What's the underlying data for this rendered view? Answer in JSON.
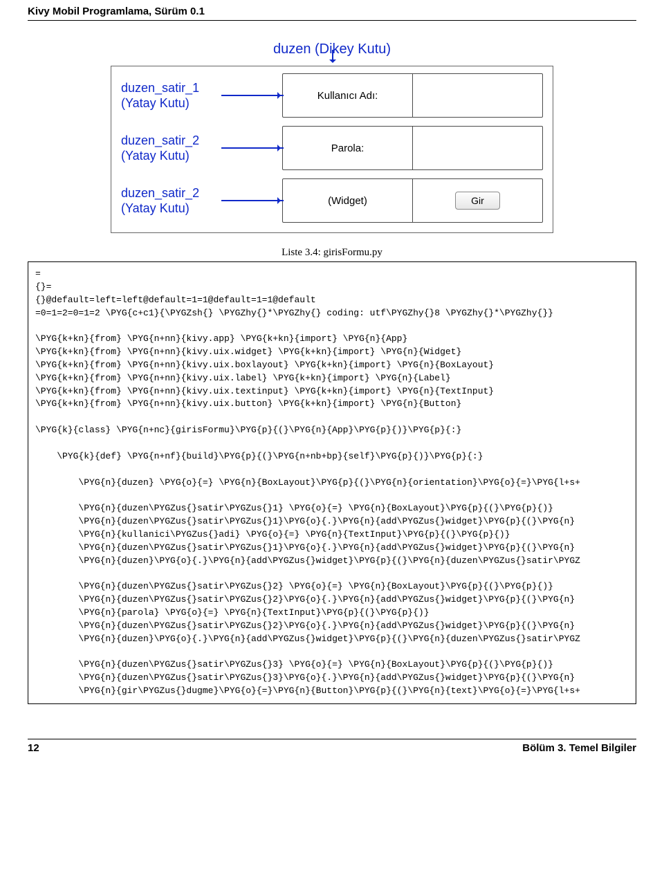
{
  "header": {
    "title": "Kivy Mobil Programlama, Sürüm 0.1"
  },
  "figure": {
    "title": "duzen (Dikey Kutu)",
    "rows": [
      {
        "caption_line1": "duzen_satir_1",
        "caption_line2": "(Yatay Kutu)",
        "cell1": "Kullanıcı Adı:",
        "cell2": ""
      },
      {
        "caption_line1": "duzen_satir_2",
        "caption_line2": "(Yatay Kutu)",
        "cell1": "Parola:",
        "cell2": ""
      },
      {
        "caption_line1": "duzen_satir_2",
        "caption_line2": "(Yatay Kutu)",
        "cell1": "(Widget)",
        "button": "Gir"
      }
    ]
  },
  "listing_caption": "Liste 3.4: girisFormu.py",
  "code": {
    "l1": "=",
    "l2": "{}=",
    "l3": "{}@default=left=left@default=1=1@default=1=1@default",
    "l4": "=0=1=2=0=1=2 \\PYG{c+c1}{\\PYGZsh{} \\PYGZhy{}*\\PYGZhy{} coding: utf\\PYGZhy{}8 \\PYGZhy{}*\\PYGZhy{}}",
    "l6": "\\PYG{k+kn}{from} \\PYG{n+nn}{kivy.app} \\PYG{k+kn}{import} \\PYG{n}{App}",
    "l7": "\\PYG{k+kn}{from} \\PYG{n+nn}{kivy.uix.widget} \\PYG{k+kn}{import} \\PYG{n}{Widget}",
    "l8": "\\PYG{k+kn}{from} \\PYG{n+nn}{kivy.uix.boxlayout} \\PYG{k+kn}{import} \\PYG{n}{BoxLayout}",
    "l9": "\\PYG{k+kn}{from} \\PYG{n+nn}{kivy.uix.label} \\PYG{k+kn}{import} \\PYG{n}{Label}",
    "l10": "\\PYG{k+kn}{from} \\PYG{n+nn}{kivy.uix.textinput} \\PYG{k+kn}{import} \\PYG{n}{TextInput}",
    "l11": "\\PYG{k+kn}{from} \\PYG{n+nn}{kivy.uix.button} \\PYG{k+kn}{import} \\PYG{n}{Button}",
    "l13": "\\PYG{k}{class} \\PYG{n+nc}{girisFormu}\\PYG{p}{(}\\PYG{n}{App}\\PYG{p}{)}\\PYG{p}{:}",
    "l15": "    \\PYG{k}{def} \\PYG{n+nf}{build}\\PYG{p}{(}\\PYG{n+nb+bp}{self}\\PYG{p}{)}\\PYG{p}{:}",
    "l17": "        \\PYG{n}{duzen} \\PYG{o}{=} \\PYG{n}{BoxLayout}\\PYG{p}{(}\\PYG{n}{orientation}\\PYG{o}{=}\\PYG{l+s+",
    "l19": "        \\PYG{n}{duzen\\PYGZus{}satir\\PYGZus{}1} \\PYG{o}{=} \\PYG{n}{BoxLayout}\\PYG{p}{(}\\PYG{p}{)}",
    "l20": "        \\PYG{n}{duzen\\PYGZus{}satir\\PYGZus{}1}\\PYG{o}{.}\\PYG{n}{add\\PYGZus{}widget}\\PYG{p}{(}\\PYG{n}",
    "l21": "        \\PYG{n}{kullanici\\PYGZus{}adi} \\PYG{o}{=} \\PYG{n}{TextInput}\\PYG{p}{(}\\PYG{p}{)}",
    "l22": "        \\PYG{n}{duzen\\PYGZus{}satir\\PYGZus{}1}\\PYG{o}{.}\\PYG{n}{add\\PYGZus{}widget}\\PYG{p}{(}\\PYG{n}",
    "l23": "        \\PYG{n}{duzen}\\PYG{o}{.}\\PYG{n}{add\\PYGZus{}widget}\\PYG{p}{(}\\PYG{n}{duzen\\PYGZus{}satir\\PYGZ",
    "l25": "        \\PYG{n}{duzen\\PYGZus{}satir\\PYGZus{}2} \\PYG{o}{=} \\PYG{n}{BoxLayout}\\PYG{p}{(}\\PYG{p}{)}",
    "l26": "        \\PYG{n}{duzen\\PYGZus{}satir\\PYGZus{}2}\\PYG{o}{.}\\PYG{n}{add\\PYGZus{}widget}\\PYG{p}{(}\\PYG{n}",
    "l27": "        \\PYG{n}{parola} \\PYG{o}{=} \\PYG{n}{TextInput}\\PYG{p}{(}\\PYG{p}{)}",
    "l28": "        \\PYG{n}{duzen\\PYGZus{}satir\\PYGZus{}2}\\PYG{o}{.}\\PYG{n}{add\\PYGZus{}widget}\\PYG{p}{(}\\PYG{n}",
    "l29": "        \\PYG{n}{duzen}\\PYG{o}{.}\\PYG{n}{add\\PYGZus{}widget}\\PYG{p}{(}\\PYG{n}{duzen\\PYGZus{}satir\\PYGZ",
    "l31": "        \\PYG{n}{duzen\\PYGZus{}satir\\PYGZus{}3} \\PYG{o}{=} \\PYG{n}{BoxLayout}\\PYG{p}{(}\\PYG{p}{)}",
    "l32": "        \\PYG{n}{duzen\\PYGZus{}satir\\PYGZus{}3}\\PYG{o}{.}\\PYG{n}{add\\PYGZus{}widget}\\PYG{p}{(}\\PYG{n}",
    "l33": "        \\PYG{n}{gir\\PYGZus{}dugme}\\PYG{o}{=}\\PYG{n}{Button}\\PYG{p}{(}\\PYG{n}{text}\\PYG{o}{=}\\PYG{l+s+"
  },
  "footer": {
    "page": "12",
    "chapter": "Bölüm 3. Temel Bilgiler"
  }
}
